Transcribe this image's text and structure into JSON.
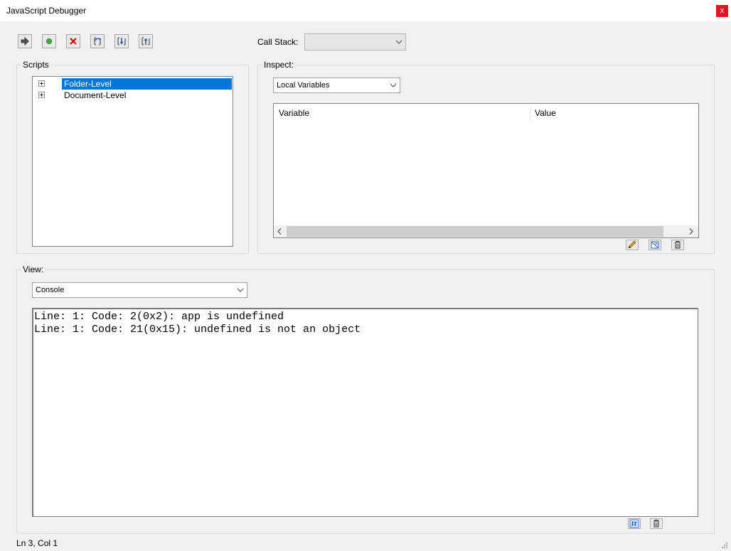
{
  "window": {
    "title": "JavaScript Debugger",
    "close_glyph": "x"
  },
  "toolbar": {
    "buttons": [
      {
        "name": "resume-icon"
      },
      {
        "name": "toggle-breakpoint-icon"
      },
      {
        "name": "stop-debugging-icon"
      },
      {
        "name": "step-over-icon"
      },
      {
        "name": "step-into-icon"
      },
      {
        "name": "step-out-icon"
      }
    ],
    "call_stack_label": "Call Stack:",
    "call_stack_value": ""
  },
  "scripts": {
    "title": "Scripts",
    "items": [
      {
        "label": "Folder-Level",
        "selected": true
      },
      {
        "label": "Document-Level",
        "selected": false
      }
    ]
  },
  "inspect": {
    "title": "Inspect:",
    "dropdown_value": "Local Variables",
    "columns": [
      "Variable",
      "Value"
    ],
    "buttons": [
      "edit-variable-icon",
      "watch-icon",
      "delete-icon"
    ]
  },
  "view": {
    "title": "View:",
    "dropdown_value": "Console",
    "console_lines": [
      "Line: 1: Code: 2(0x2): app is undefined",
      "Line: 1: Code: 21(0x15): undefined is not an object"
    ],
    "buttons": [
      "run-script-icon",
      "clear-console-icon"
    ]
  },
  "status": {
    "text": "Ln 3, Col 1"
  },
  "colors": {
    "selection": "#0078d7",
    "close": "#e81123"
  }
}
